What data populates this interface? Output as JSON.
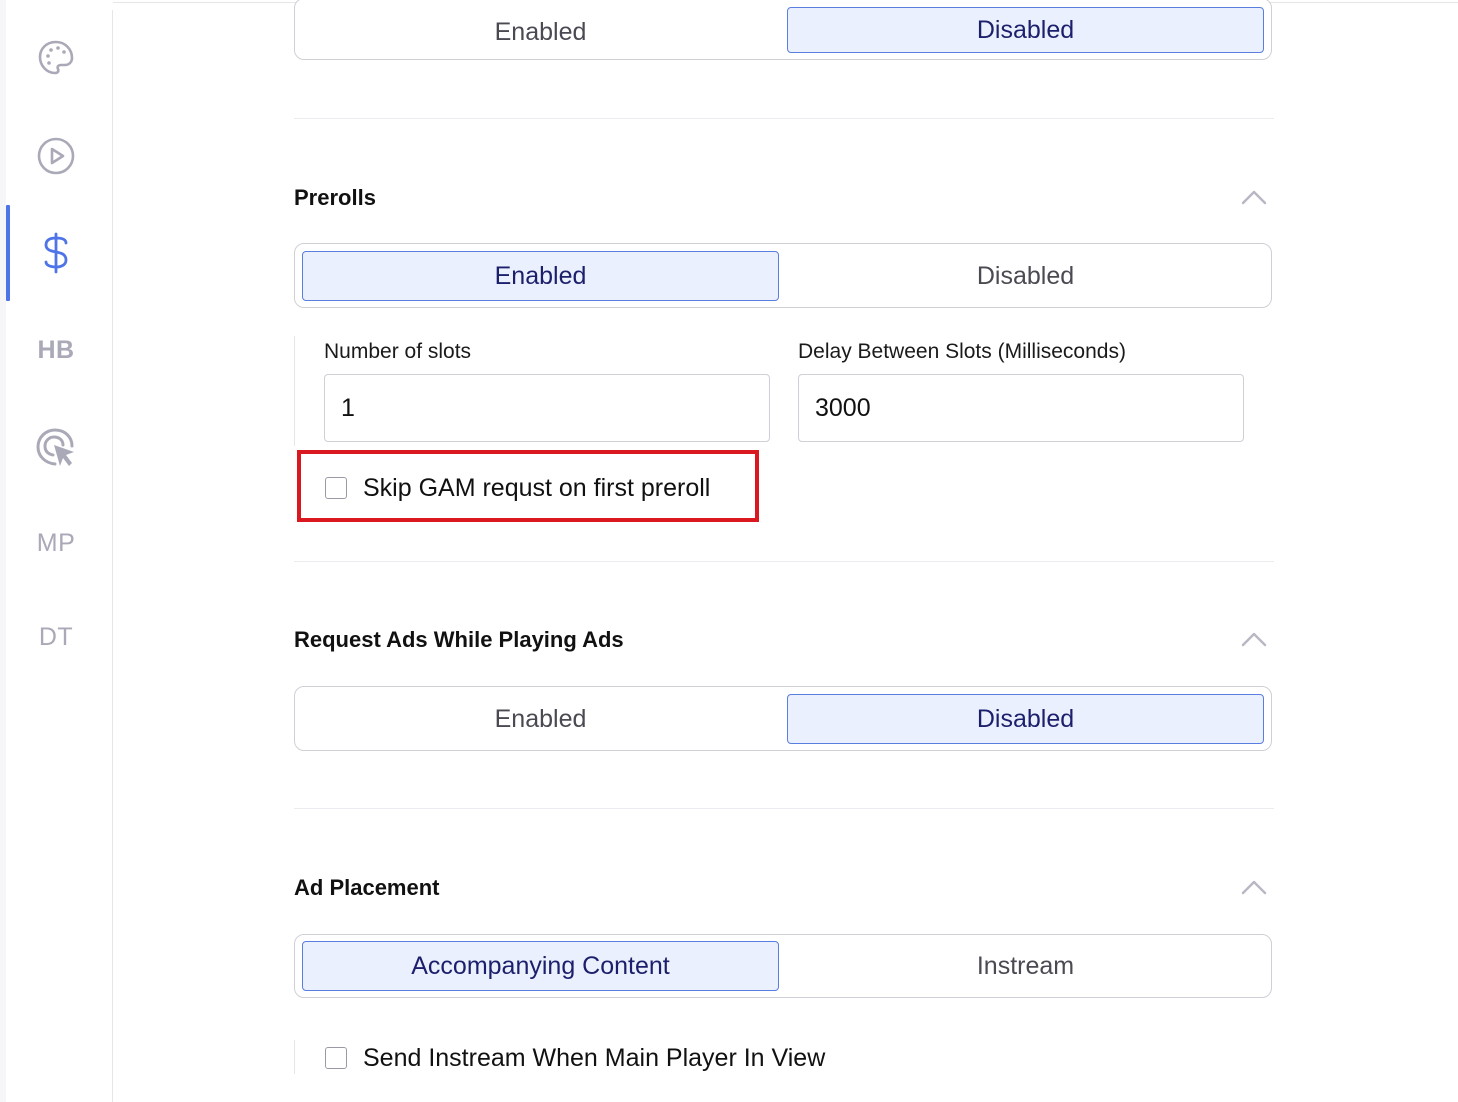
{
  "sidebar": {
    "items": [
      {
        "name": "palette-icon"
      },
      {
        "name": "play-circle-icon"
      },
      {
        "name": "dollar-icon",
        "active": true
      },
      {
        "name": "hb-icon",
        "label": "HB"
      },
      {
        "name": "cursor-target-icon"
      },
      {
        "name": "mp-icon",
        "label": "MP"
      },
      {
        "name": "dt-icon",
        "label": "DT"
      }
    ],
    "accent_color": "#4f74e8"
  },
  "top_toggle": {
    "options": [
      "Enabled",
      "Disabled"
    ],
    "selected": "Disabled"
  },
  "prerolls": {
    "title": "Prerolls",
    "options": [
      "Enabled",
      "Disabled"
    ],
    "selected": "Enabled",
    "number_of_slots_label": "Number of slots",
    "number_of_slots_value": "1",
    "delay_label": "Delay Between Slots (Milliseconds)",
    "delay_value": "3000",
    "skip_gam_label": "Skip GAM requst on first preroll",
    "skip_gam_checked": false
  },
  "request_ads": {
    "title": "Request Ads While Playing Ads",
    "options": [
      "Enabled",
      "Disabled"
    ],
    "selected": "Disabled"
  },
  "ad_placement": {
    "title": "Ad Placement",
    "options": [
      "Accompanying Content",
      "Instream"
    ],
    "selected": "Accompanying Content",
    "send_instream_label": "Send Instream When Main Player In View",
    "send_instream_checked": false
  },
  "colors": {
    "active_segment_bg": "#eaf0fd",
    "active_segment_border": "#5a7de0",
    "highlight": "#d91820"
  }
}
